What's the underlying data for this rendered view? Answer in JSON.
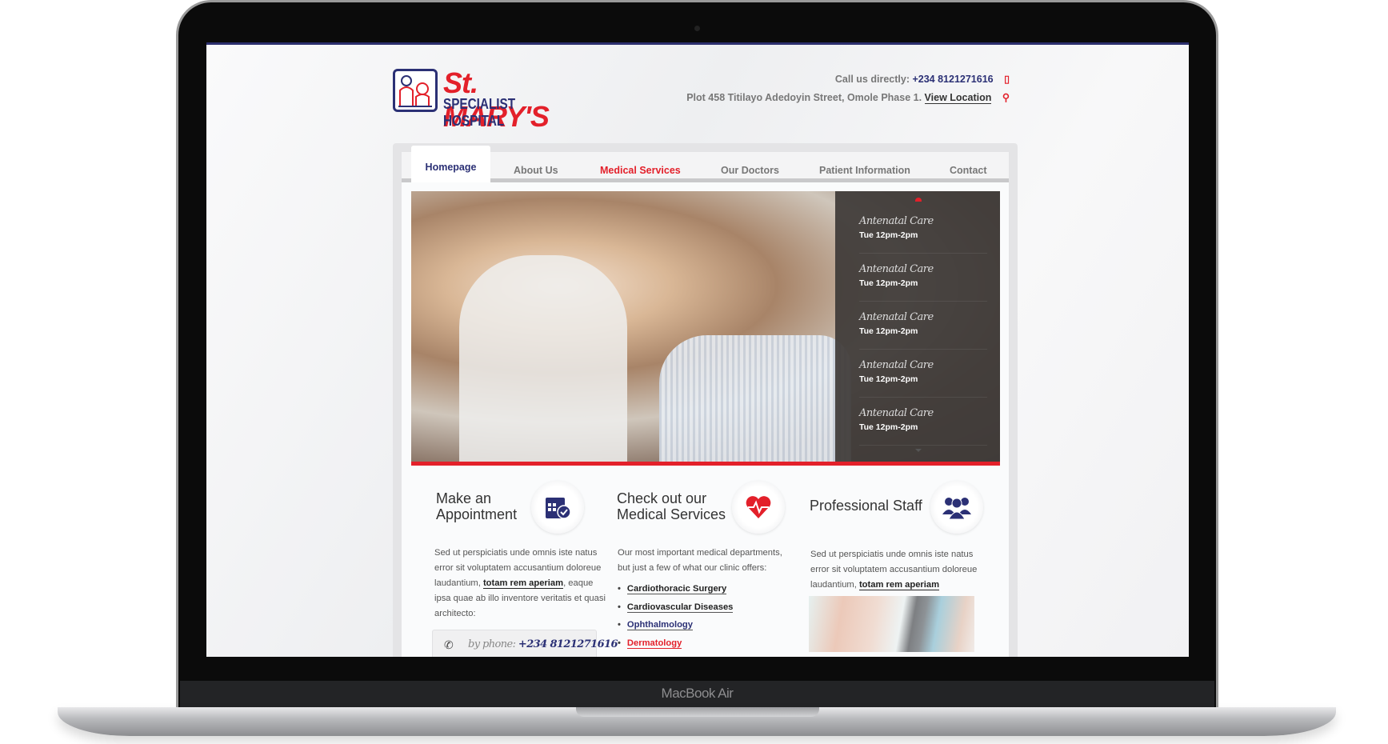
{
  "device": {
    "label": "MacBook Air"
  },
  "header": {
    "logo": {
      "line1": "St. MARY'S",
      "line2": "SPECIALIST HOSPITAL"
    },
    "call_label": "Call us directly:",
    "phone": "+234 8121271616",
    "address": "Plot 458 Titilayo Adedoyin Street, Omole Phase 1.",
    "location_link": "View Location",
    "icons": {
      "phone": "mobile-phone-icon",
      "location": "map-pin-icon"
    }
  },
  "nav": {
    "items": [
      "Homepage",
      "About Us",
      "Medical Services",
      "Our Doctors",
      "Patient Information",
      "Contact"
    ],
    "active": "Homepage",
    "hovered": "Medical Services"
  },
  "schedule": [
    {
      "name": "Antenatal Care",
      "time": "Tue 12pm-2pm"
    },
    {
      "name": "Antenatal Care",
      "time": "Tue 12pm-2pm"
    },
    {
      "name": "Antenatal Care",
      "time": "Tue 12pm-2pm"
    },
    {
      "name": "Antenatal Care",
      "time": "Tue 12pm-2pm"
    },
    {
      "name": "Antenatal Care",
      "time": "Tue 12pm-2pm"
    }
  ],
  "features": {
    "appointment": {
      "title_1": "Make an",
      "title_2": "Appointment",
      "text_1": "Sed ut perspiciatis unde omnis iste natus error sit voluptatem accusantium doloreue laudantium,",
      "link": "totam rem aperiam",
      "text_2": ", eaque ipsa quae ab illo inventore veritatis et quasi architecto:",
      "phone_label": "by phone:",
      "phone": "+234 8121271616"
    },
    "services": {
      "title_1": "Check out our",
      "title_2": "Medical Services",
      "intro": "Our most important medical departments, but just a few of what our clinic offers:",
      "items": [
        "Cardiothoracic Surgery",
        "Cardiovascular Diseases",
        "Ophthalmology",
        "Dermatology"
      ]
    },
    "staff": {
      "title": "Professional Staff",
      "text": "Sed ut perspiciatis unde omnis iste natus error sit voluptatem accusantium doloreue laudantium,",
      "link": "totam rem aperiam"
    }
  },
  "colors": {
    "brand_red": "#e3202a",
    "brand_navy": "#2b3075"
  }
}
